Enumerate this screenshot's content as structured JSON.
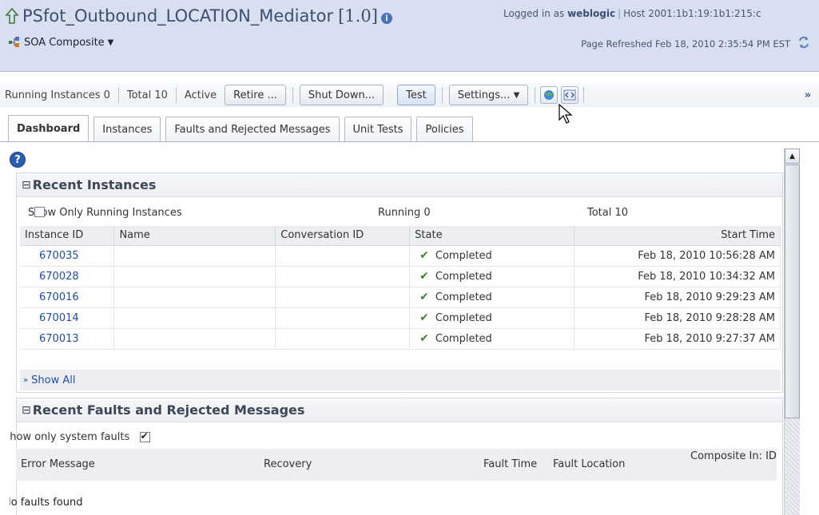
{
  "header": {
    "title": "PSfot_Outbound_LOCATION_Mediator",
    "version": "[1.0]",
    "login_prefix": "Logged in as",
    "user": "weblogic",
    "host": "Host 2001:1b1:19:1b1:215:c",
    "composite_menu": "SOA Composite",
    "page_refreshed": "Page Refreshed Feb 18, 2010 2:35:54 PM EST"
  },
  "toolbar": {
    "running_instances": "Running Instances 0",
    "total": "Total 10",
    "active": "Active",
    "retire": "Retire ...",
    "shut_down": "Shut Down...",
    "test": "Test",
    "settings": "Settings...",
    "more": "»"
  },
  "tabs": [
    "Dashboard",
    "Instances",
    "Faults and Rejected Messages",
    "Unit Tests",
    "Policies"
  ],
  "recent_instances": {
    "title": "Recent Instances",
    "show_running_label": "Show Only Running Instances",
    "running": "Running  0",
    "total": "Total  10",
    "columns": [
      "Instance ID",
      "Name",
      "Conversation ID",
      "State",
      "Start Time"
    ],
    "rows": [
      {
        "id": "670035",
        "name": "",
        "conversation": "",
        "state": "Completed",
        "start": "Feb 18, 2010 10:56:28 AM"
      },
      {
        "id": "670028",
        "name": "",
        "conversation": "",
        "state": "Completed",
        "start": "Feb 18, 2010 10:34:32 AM"
      },
      {
        "id": "670016",
        "name": "",
        "conversation": "",
        "state": "Completed",
        "start": "Feb 18, 2010 9:29:23 AM"
      },
      {
        "id": "670014",
        "name": "",
        "conversation": "",
        "state": "Completed",
        "start": "Feb 18, 2010 9:28:28 AM"
      },
      {
        "id": "670013",
        "name": "",
        "conversation": "",
        "state": "Completed",
        "start": "Feb 18, 2010 9:27:37 AM"
      }
    ],
    "show_all": "Show All"
  },
  "recent_faults": {
    "title": "Recent Faults and Rejected Messages",
    "system_faults_label": "Show only system faults",
    "columns": [
      "Error Message",
      "Recovery",
      "Fault Time",
      "Fault Location",
      "Composite In: ID"
    ],
    "empty": "No faults found"
  },
  "icons": {
    "up": "up-arrow-icon",
    "info": "info-icon",
    "composite": "soa-composite-icon",
    "refresh": "refresh-icon",
    "help": "help-icon",
    "check": "check-icon"
  },
  "colors": {
    "header_bg": "#d7dff0",
    "link": "#1f4ea3",
    "success": "#3a8a2c"
  }
}
